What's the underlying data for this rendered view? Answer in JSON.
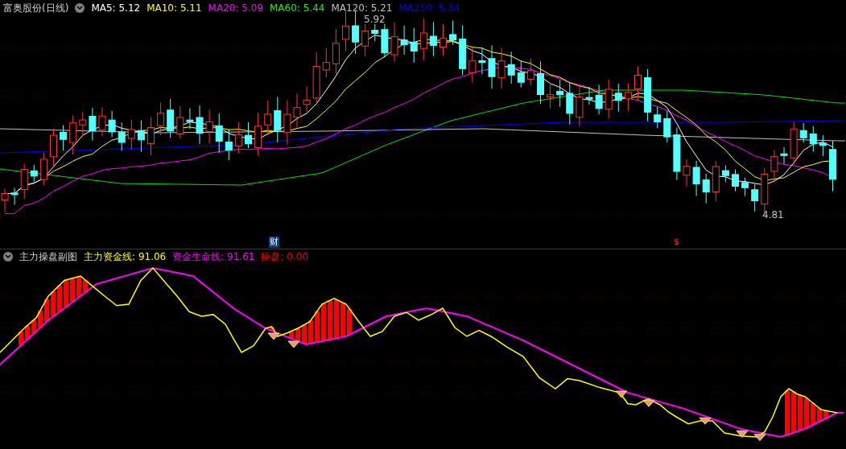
{
  "main_panel": {
    "title": "富奥股份(日线)",
    "indicators": [
      {
        "label": "MA5:",
        "value": "5.12",
        "color": "#ffffff"
      },
      {
        "label": "MA10:",
        "value": "5.11",
        "color": "#ffff00"
      },
      {
        "label": "MA20:",
        "value": "5.09",
        "color": "#ff00ff"
      },
      {
        "label": "MA60:",
        "value": "5.44",
        "color": "#00ff00"
      },
      {
        "label": "MA120:",
        "value": "5.21",
        "color": "#c0c0c0"
      },
      {
        "label": "MA250:",
        "value": "5.34",
        "color": "#0000ff"
      }
    ],
    "high_label": "5.92",
    "low_label": "4.81",
    "markers": [
      {
        "kind": "finance",
        "text": "财"
      },
      {
        "kind": "dollar",
        "text": "$"
      }
    ]
  },
  "sub_panel": {
    "title": "主力操盘副图",
    "indicators": [
      {
        "label": "主力资金线:",
        "value": "91.06",
        "color": "#ffff00"
      },
      {
        "label": "资金生命线:",
        "value": "91.61",
        "color": "#ff00ff"
      },
      {
        "label": "操盘:",
        "value": "0.00",
        "color": "#ff0000"
      }
    ]
  }
}
